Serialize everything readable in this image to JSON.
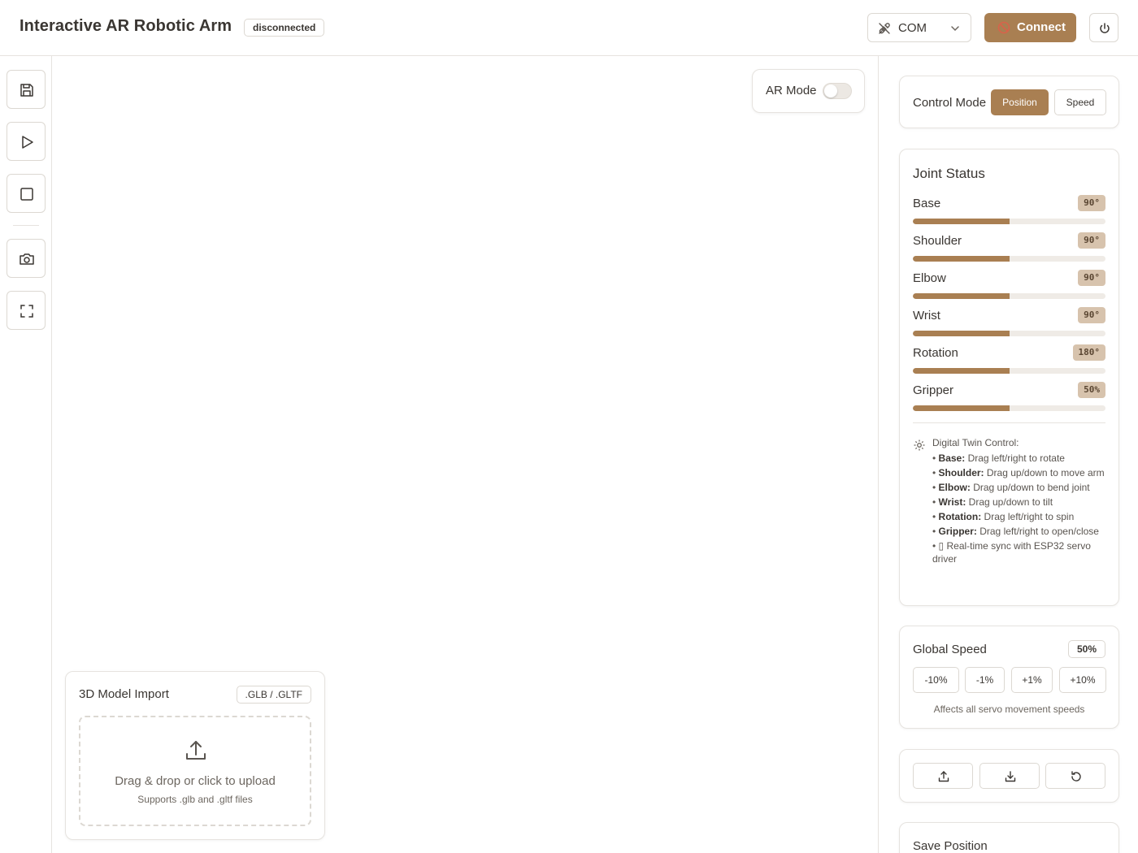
{
  "header": {
    "title": "Interactive AR Robotic Arm",
    "status": "disconnected",
    "port_value": "COM",
    "connect_label": "Connect",
    "accent_color": "#a97f52"
  },
  "toolbar": {
    "items": [
      {
        "icon": "save-icon"
      },
      {
        "icon": "play-icon"
      },
      {
        "icon": "stop-icon"
      },
      {
        "icon": "camera-icon"
      },
      {
        "icon": "fullscreen-icon"
      }
    ]
  },
  "viewport": {
    "ar_mode_label": "AR Mode",
    "ar_mode_enabled": false
  },
  "model_import": {
    "title": "3D Model Import",
    "formats": ".GLB / .GLTF",
    "drop_text": "Drag & drop or click to upload",
    "drop_subtext": "Supports .glb and .gltf files"
  },
  "control_mode": {
    "label": "Control Mode",
    "options": [
      "Position",
      "Speed"
    ],
    "selected": "Position"
  },
  "joint_status": {
    "title": "Joint Status",
    "joints": [
      {
        "name": "Base",
        "value": "90°",
        "level": 0.5
      },
      {
        "name": "Shoulder",
        "value": "90°",
        "level": 0.5
      },
      {
        "name": "Elbow",
        "value": "90°",
        "level": 0.5
      },
      {
        "name": "Wrist",
        "value": "90°",
        "level": 0.5
      },
      {
        "name": "Rotation",
        "value": "180°",
        "level": 0.5
      },
      {
        "name": "Gripper",
        "value": "50%",
        "level": 0.5
      }
    ],
    "help_title": "Digital Twin Control:",
    "help_items": [
      {
        "bold": "Base:",
        "text": " Drag left/right to rotate"
      },
      {
        "bold": "Shoulder:",
        "text": " Drag up/down to move arm"
      },
      {
        "bold": "Elbow:",
        "text": " Drag up/down to bend joint"
      },
      {
        "bold": "Wrist:",
        "text": " Drag up/down to tilt"
      },
      {
        "bold": "Rotation:",
        "text": " Drag left/right to spin"
      },
      {
        "bold": "Gripper:",
        "text": " Drag left/right to open/close"
      },
      {
        "bold": "",
        "text": "▯ Real-time sync with ESP32 servo driver"
      }
    ]
  },
  "global_speed": {
    "title": "Global Speed",
    "value": "50%",
    "buttons": [
      "-10%",
      "-1%",
      "+1%",
      "+10%"
    ],
    "note": "Affects all servo movement speeds"
  },
  "io_actions": {
    "items": [
      {
        "icon": "upload-icon"
      },
      {
        "icon": "download-icon"
      },
      {
        "icon": "reset-icon"
      }
    ]
  },
  "save_position": {
    "title": "Save Position"
  }
}
